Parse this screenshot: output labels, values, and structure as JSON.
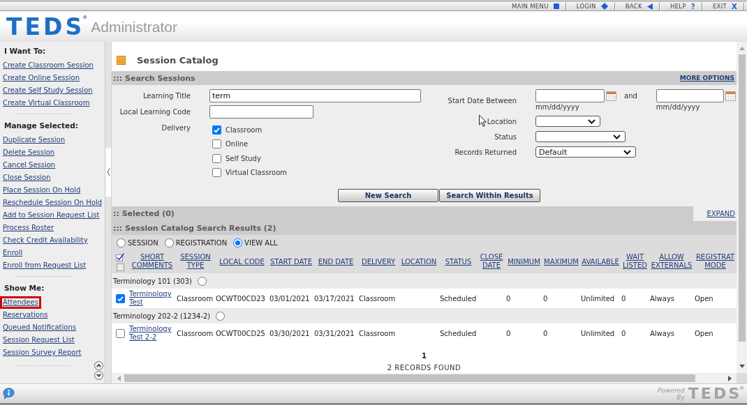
{
  "top_menu": [
    {
      "label": "MAIN MENU"
    },
    {
      "label": "LOGIN"
    },
    {
      "label": "BACK"
    },
    {
      "label": "HELP",
      "glyph": "?"
    },
    {
      "label": "EXIT",
      "glyph": "X"
    }
  ],
  "header": {
    "logo": "TEDS",
    "logo_mark": "®",
    "app_name": "Administrator"
  },
  "sidebar": {
    "sections": [
      {
        "title": "I Want To:",
        "items": [
          {
            "label": "Create Classroom Session",
            "highlighted": false
          },
          {
            "label": "Create Online Session",
            "highlighted": false
          },
          {
            "label": "Create Self Study Session",
            "highlighted": false
          },
          {
            "label": "Create Virtual Classroom",
            "highlighted": false
          }
        ]
      },
      {
        "title": "Manage Selected:",
        "items": [
          {
            "label": "Duplicate Session",
            "highlighted": false
          },
          {
            "label": "Delete Session",
            "highlighted": false
          },
          {
            "label": "Cancel Session",
            "highlighted": false
          },
          {
            "label": "Close Session",
            "highlighted": false
          },
          {
            "label": "Place Session On Hold",
            "highlighted": false
          },
          {
            "label": "Reschedule Session On Hold",
            "highlighted": false
          },
          {
            "label": "Add to Session Request List",
            "highlighted": false
          },
          {
            "label": "Process Roster",
            "highlighted": false
          },
          {
            "label": "Check Credit Availability",
            "highlighted": false
          },
          {
            "label": "Enroll",
            "highlighted": false
          },
          {
            "label": "Enroll from Request List",
            "highlighted": false
          }
        ]
      },
      {
        "title": "Show Me:",
        "items": [
          {
            "label": "Attendees",
            "highlighted": true
          },
          {
            "label": "Reservations",
            "highlighted": false
          },
          {
            "label": "Queued Notifications",
            "highlighted": false
          },
          {
            "label": "Session Request List",
            "highlighted": false
          },
          {
            "label": "Session Survey Report",
            "highlighted": false
          }
        ]
      }
    ]
  },
  "page": {
    "title": "Session Catalog"
  },
  "search": {
    "title": "::: Search Sessions",
    "more_options": "MORE OPTIONS",
    "learning_title": {
      "label": "Learning Title",
      "value": "term"
    },
    "local_code": {
      "label": "Local Learning Code"
    },
    "delivery": {
      "label": "Delivery",
      "options": [
        {
          "label": "Classroom",
          "checked": true
        },
        {
          "label": "Online",
          "checked": false
        },
        {
          "label": "Self Study",
          "checked": false
        },
        {
          "label": "Virtual Classroom",
          "checked": false
        }
      ]
    },
    "start_date": {
      "label": "Start Date Between",
      "joiner": "and",
      "from_format": "mm/dd/yyyy",
      "to_format": "mm/dd/yyyy"
    },
    "selects": [
      {
        "label": "Location"
      },
      {
        "label": "Status"
      },
      {
        "label": "Records Returned",
        "value": "Default"
      }
    ],
    "buttons": [
      "New Search",
      "Search Within Results"
    ]
  },
  "selected_bar": {
    "title": ":: Selected (0)",
    "expand": "EXPAND"
  },
  "results": {
    "title": "::: Session Catalog Search Results (2)",
    "views": [
      {
        "label": "SESSION",
        "selected": false
      },
      {
        "label": "REGISTRATION",
        "selected": false
      },
      {
        "label": "VIEW ALL",
        "selected": true
      }
    ],
    "header_checkbox": {
      "checked": false
    },
    "columns": [
      "SHORT COMMENTS",
      "SESSION TYPE",
      "LOCAL CODE",
      "START DATE",
      "END DATE",
      "DELIVERY",
      "LOCATION",
      "STATUS",
      "CLOSE DATE",
      "MINIMUM",
      "MAXIMUM",
      "AVAILABLE",
      "WAIT LISTED",
      "ALLOW EXTERNALS",
      "REGISTRAT MODE"
    ],
    "groups": [
      {
        "name": "Terminology 101 (303)",
        "selected": false,
        "rows": [
          {
            "checked": true,
            "link": "Terminology Test",
            "cells": [
              "Classroom",
              "OCWT00CD23",
              "03/01/2021",
              "03/17/2021",
              "Classroom",
              null,
              "Scheduled",
              null,
              "0",
              "0",
              "Unlimited",
              "0",
              "Always",
              "Open"
            ]
          }
        ]
      },
      {
        "name": "Terminology 202-2 (1234-2)",
        "selected": false,
        "rows": [
          {
            "checked": false,
            "link": "Terminology Test 2-2",
            "cells": [
              "Classroom",
              "OCWT00CD25",
              "03/30/2021",
              "03/31/2021",
              "Classroom",
              null,
              "Scheduled",
              null,
              "0",
              "0",
              "Unlimited",
              "0",
              "Always",
              "Open"
            ]
          }
        ]
      }
    ],
    "pagination": "1",
    "records_found": "2 RECORDS FOUND"
  },
  "footer": {
    "powered_by": "Powered By",
    "logo": "TEDS",
    "logo_mark": "®"
  }
}
